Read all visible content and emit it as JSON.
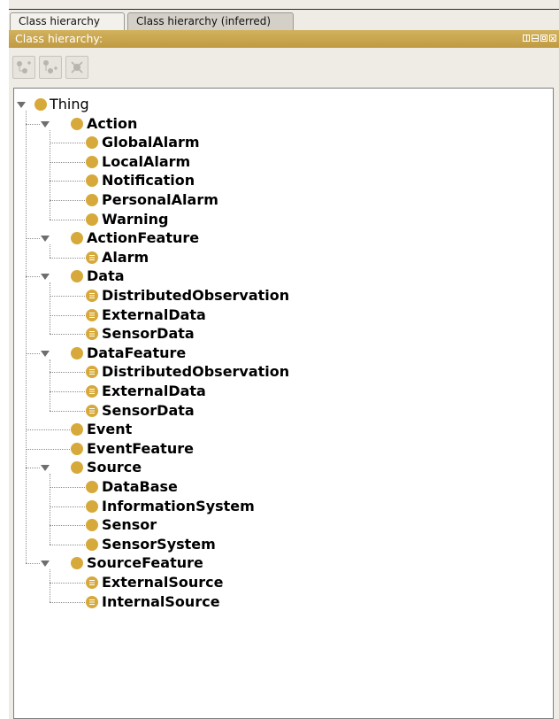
{
  "tabs": [
    {
      "label": "Class hierarchy",
      "active": true
    },
    {
      "label": "Class hierarchy (inferred)",
      "active": false
    }
  ],
  "panel": {
    "title": "Class hierarchy:",
    "window_buttons": [
      "split-icon",
      "minimize-icon",
      "maximize-icon",
      "close-icon"
    ]
  },
  "toolbar": {
    "buttons": [
      {
        "name": "add-subclass-button",
        "icon": "add-subclass-icon"
      },
      {
        "name": "add-sibling-button",
        "icon": "add-sibling-icon"
      },
      {
        "name": "delete-class-button",
        "icon": "delete-class-icon"
      }
    ]
  },
  "colors": {
    "title_bar": "#c9a44e",
    "class_dot": "#d6a93a",
    "tree_background": "#ffffff"
  },
  "tree": {
    "root": "Thing",
    "children": [
      {
        "label": "Action",
        "expanded": true,
        "children": [
          {
            "label": "GlobalAlarm",
            "defined": false
          },
          {
            "label": "LocalAlarm",
            "defined": false
          },
          {
            "label": "Notification",
            "defined": false
          },
          {
            "label": "PersonalAlarm",
            "defined": false
          },
          {
            "label": "Warning",
            "defined": false
          }
        ]
      },
      {
        "label": "ActionFeature",
        "expanded": true,
        "children": [
          {
            "label": "Alarm",
            "defined": true
          }
        ]
      },
      {
        "label": "Data",
        "expanded": true,
        "children": [
          {
            "label": "DistributedObservation",
            "defined": true
          },
          {
            "label": "ExternalData",
            "defined": true
          },
          {
            "label": "SensorData",
            "defined": true
          }
        ]
      },
      {
        "label": "DataFeature",
        "expanded": true,
        "children": [
          {
            "label": "DistributedObservation",
            "defined": true
          },
          {
            "label": "ExternalData",
            "defined": true
          },
          {
            "label": "SensorData",
            "defined": true
          }
        ]
      },
      {
        "label": "Event",
        "expanded": false,
        "children": []
      },
      {
        "label": "EventFeature",
        "expanded": false,
        "children": []
      },
      {
        "label": "Source",
        "expanded": true,
        "children": [
          {
            "label": "DataBase",
            "defined": false
          },
          {
            "label": "InformationSystem",
            "defined": false
          },
          {
            "label": "Sensor",
            "defined": false
          },
          {
            "label": "SensorSystem",
            "defined": false
          }
        ]
      },
      {
        "label": "SourceFeature",
        "expanded": true,
        "children": [
          {
            "label": "ExternalSource",
            "defined": true
          },
          {
            "label": "InternalSource",
            "defined": true
          }
        ]
      }
    ]
  }
}
